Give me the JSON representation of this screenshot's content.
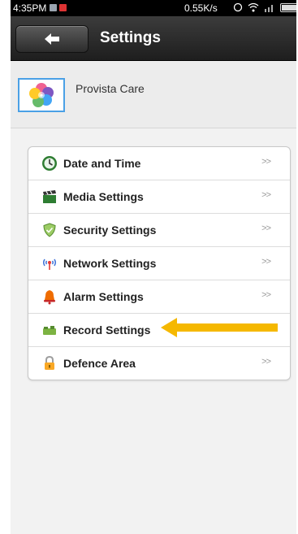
{
  "status_bar": {
    "time": "4:35PM",
    "net_speed": "0.55K/s"
  },
  "header": {
    "back_icon": "back-arrow-icon",
    "title": "Settings"
  },
  "device": {
    "name": "Provista Care",
    "icon": "flower-logo-icon"
  },
  "menu": {
    "items": [
      {
        "label": "Date and Time",
        "icon": "clock-icon",
        "chevron": ">>"
      },
      {
        "label": "Media Settings",
        "icon": "clapperboard-icon",
        "chevron": ">>"
      },
      {
        "label": "Security Settings",
        "icon": "shield-icon",
        "chevron": ">>"
      },
      {
        "label": "Network Settings",
        "icon": "antenna-icon",
        "chevron": ">>"
      },
      {
        "label": "Alarm Settings",
        "icon": "bell-icon",
        "chevron": ">>"
      },
      {
        "label": "Record Settings",
        "icon": "camera-icon",
        "chevron": ">>"
      },
      {
        "label": "Defence Area",
        "icon": "lock-icon",
        "chevron": ">>"
      }
    ]
  },
  "annotation": {
    "icon": "pointer-arrow-icon",
    "color": "#f5b800"
  },
  "colors": {
    "titlebar": "#2a2a2a",
    "accent": "#4aa0e6"
  }
}
